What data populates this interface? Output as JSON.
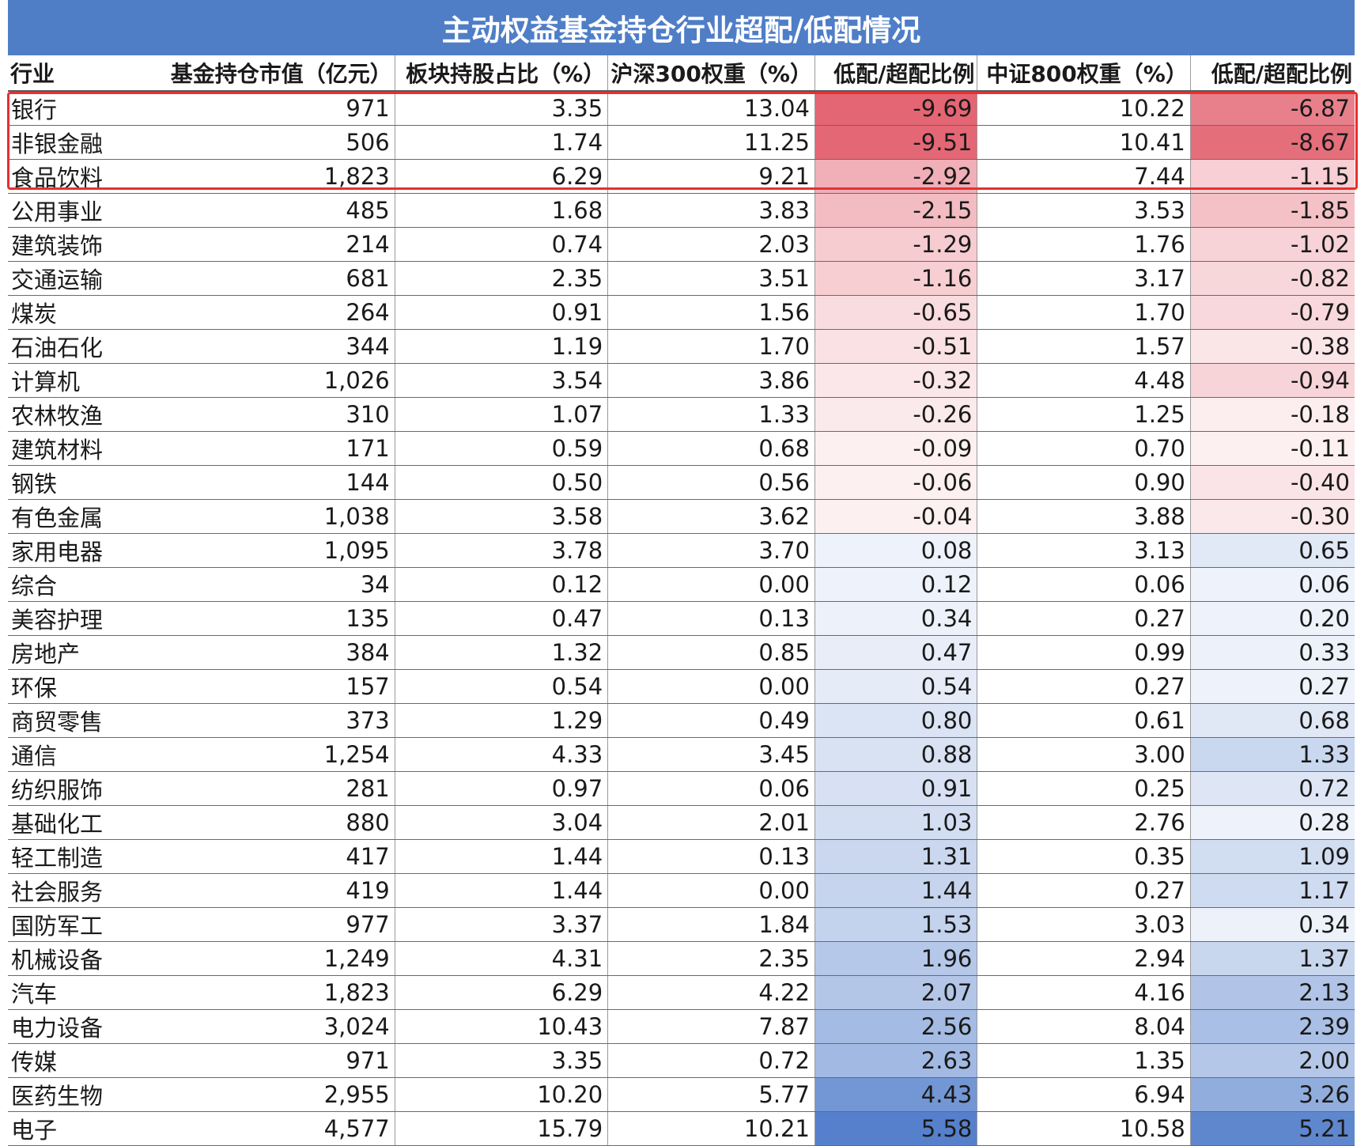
{
  "chart_data": {
    "type": "table",
    "title": "主动权益基金持仓行业超配/低配情况",
    "columns": [
      "行业",
      "基金持仓市值（亿元）",
      "板块持股占比（%）",
      "沪深300权重（%）",
      "低配/超配比例",
      "中证800权重（%）",
      "低配/超配比例"
    ],
    "rows": [
      [
        "银行",
        "971",
        "3.35",
        "13.04",
        "-9.69",
        "10.22",
        "-6.87"
      ],
      [
        "非银金融",
        "506",
        "1.74",
        "11.25",
        "-9.51",
        "10.41",
        "-8.67"
      ],
      [
        "食品饮料",
        "1,823",
        "6.29",
        "9.21",
        "-2.92",
        "7.44",
        "-1.15"
      ],
      [
        "公用事业",
        "485",
        "1.68",
        "3.83",
        "-2.15",
        "3.53",
        "-1.85"
      ],
      [
        "建筑装饰",
        "214",
        "0.74",
        "2.03",
        "-1.29",
        "1.76",
        "-1.02"
      ],
      [
        "交通运输",
        "681",
        "2.35",
        "3.51",
        "-1.16",
        "3.17",
        "-0.82"
      ],
      [
        "煤炭",
        "264",
        "0.91",
        "1.56",
        "-0.65",
        "1.70",
        "-0.79"
      ],
      [
        "石油石化",
        "344",
        "1.19",
        "1.70",
        "-0.51",
        "1.57",
        "-0.38"
      ],
      [
        "计算机",
        "1,026",
        "3.54",
        "3.86",
        "-0.32",
        "4.48",
        "-0.94"
      ],
      [
        "农林牧渔",
        "310",
        "1.07",
        "1.33",
        "-0.26",
        "1.25",
        "-0.18"
      ],
      [
        "建筑材料",
        "171",
        "0.59",
        "0.68",
        "-0.09",
        "0.70",
        "-0.11"
      ],
      [
        "钢铁",
        "144",
        "0.50",
        "0.56",
        "-0.06",
        "0.90",
        "-0.40"
      ],
      [
        "有色金属",
        "1,038",
        "3.58",
        "3.62",
        "-0.04",
        "3.88",
        "-0.30"
      ],
      [
        "家用电器",
        "1,095",
        "3.78",
        "3.70",
        "0.08",
        "3.13",
        "0.65"
      ],
      [
        "综合",
        "34",
        "0.12",
        "0.00",
        "0.12",
        "0.06",
        "0.06"
      ],
      [
        "美容护理",
        "135",
        "0.47",
        "0.13",
        "0.34",
        "0.27",
        "0.20"
      ],
      [
        "房地产",
        "384",
        "1.32",
        "0.85",
        "0.47",
        "0.99",
        "0.33"
      ],
      [
        "环保",
        "157",
        "0.54",
        "0.00",
        "0.54",
        "0.27",
        "0.27"
      ],
      [
        "商贸零售",
        "373",
        "1.29",
        "0.49",
        "0.80",
        "0.61",
        "0.68"
      ],
      [
        "通信",
        "1,254",
        "4.33",
        "3.45",
        "0.88",
        "3.00",
        "1.33"
      ],
      [
        "纺织服饰",
        "281",
        "0.97",
        "0.06",
        "0.91",
        "0.25",
        "0.72"
      ],
      [
        "基础化工",
        "880",
        "3.04",
        "2.01",
        "1.03",
        "2.76",
        "0.28"
      ],
      [
        "轻工制造",
        "417",
        "1.44",
        "0.13",
        "1.31",
        "0.35",
        "1.09"
      ],
      [
        "社会服务",
        "419",
        "1.44",
        "0.00",
        "1.44",
        "0.27",
        "1.17"
      ],
      [
        "国防军工",
        "977",
        "3.37",
        "1.84",
        "1.53",
        "3.03",
        "0.34"
      ],
      [
        "机械设备",
        "1,249",
        "4.31",
        "2.35",
        "1.96",
        "2.94",
        "1.37"
      ],
      [
        "汽车",
        "1,823",
        "6.29",
        "4.22",
        "2.07",
        "4.16",
        "2.13"
      ],
      [
        "电力设备",
        "3,024",
        "10.43",
        "7.87",
        "2.56",
        "8.04",
        "2.39"
      ],
      [
        "传媒",
        "971",
        "3.35",
        "0.72",
        "2.63",
        "1.35",
        "2.00"
      ],
      [
        "医药生物",
        "2,955",
        "10.20",
        "5.77",
        "4.43",
        "6.94",
        "3.26"
      ],
      [
        "电子",
        "4,577",
        "15.79",
        "10.21",
        "5.58",
        "10.58",
        "5.21"
      ]
    ],
    "heatmap_columns": [
      4,
      6
    ],
    "highlighted_rows": [
      0,
      1,
      2
    ],
    "colors": {
      "header_bg": "#4f7ec7",
      "header_text": "#ffffff",
      "negative": "#e05060",
      "positive": "#3f6fc4",
      "highlight_border": "#e63030"
    }
  }
}
